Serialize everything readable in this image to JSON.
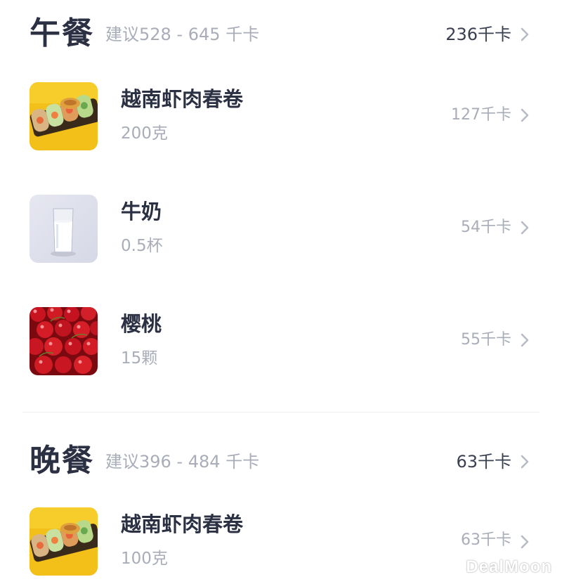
{
  "meals": [
    {
      "title": "午餐",
      "suggestion": "建议528 - 645 千卡",
      "total": "236千卡",
      "items": [
        {
          "name": "越南虾肉春卷",
          "amount": "200克",
          "kcal": "127千卡",
          "image": "spring-roll"
        },
        {
          "name": "牛奶",
          "amount": "0.5杯",
          "kcal": "54千卡",
          "image": "milk"
        },
        {
          "name": "樱桃",
          "amount": "15颗",
          "kcal": "55千卡",
          "image": "cherries"
        }
      ]
    },
    {
      "title": "晚餐",
      "suggestion": "建议396 - 484 千卡",
      "total": "63千卡",
      "items": [
        {
          "name": "越南虾肉春卷",
          "amount": "100克",
          "kcal": "63千卡",
          "image": "spring-roll"
        }
      ]
    }
  ],
  "watermark": "DealMoon",
  "icons": {
    "chevron": "chevron-right-icon"
  },
  "colors": {
    "title": "#2b3142",
    "muted": "#a9adb8",
    "total": "#3a4050"
  }
}
